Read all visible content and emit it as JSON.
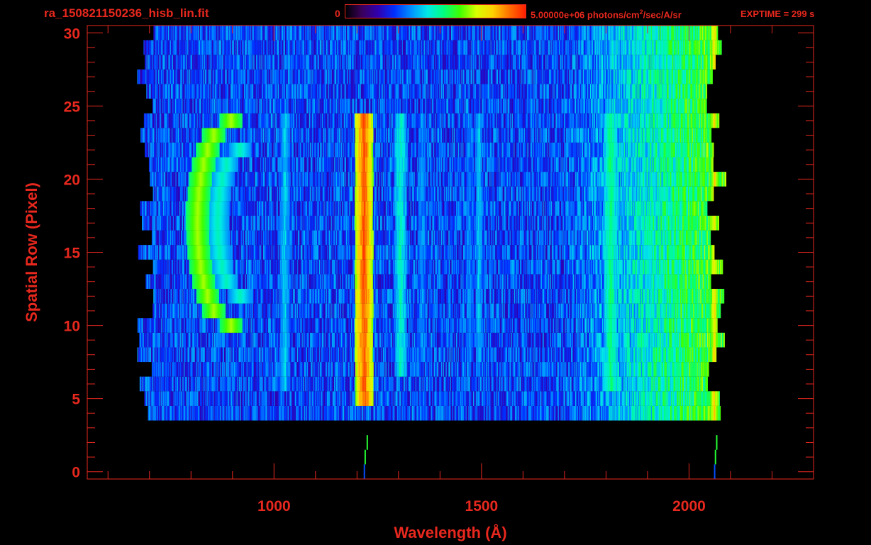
{
  "header": {
    "filename": "ra_150821150236_hisb_lin.fit",
    "colorbar_min_label": "0",
    "colorbar_max_prefix": "5.00000e+06 photons/cm",
    "colorbar_max_exp": "2",
    "colorbar_max_suffix": "/sec/A/sr",
    "exptime": "EXPTIME = 299 s"
  },
  "colors": {
    "axis": "#e8281e",
    "background": "#000000",
    "colormap": [
      "#000000",
      "#3a005a",
      "#3000b0",
      "#0030ff",
      "#0090ff",
      "#00e8e8",
      "#00ff80",
      "#40ff00",
      "#d8ff00",
      "#ffd000",
      "#ff7000",
      "#ff2000"
    ]
  },
  "chart_data": {
    "type": "heatmap",
    "title": "ra_150821150236_hisb_lin.fit",
    "xlabel": "Wavelength (Å)",
    "ylabel": "Spatial Row (Pixel)",
    "xlim": [
      550,
      2300
    ],
    "ylim": [
      -0.5,
      30.5
    ],
    "xticks": [
      1000,
      1500,
      2000
    ],
    "yticks": [
      0,
      5,
      10,
      15,
      20,
      25,
      30
    ],
    "colorbar": {
      "min": 0,
      "max": 5000000,
      "units": "photons/cm2/sec/A/sr"
    },
    "slit_rows": [
      4,
      30
    ],
    "data_x_range": [
      690,
      2090
    ],
    "features": [
      {
        "name": "Lyman-beta arc",
        "shape": "arc",
        "x_center": 855,
        "x_width": 90,
        "rows": [
          10,
          24
        ],
        "intensity": 0.55
      },
      {
        "name": "arc inner",
        "shape": "arc",
        "x_center": 890,
        "x_width": 60,
        "rows": [
          12,
          22
        ],
        "intensity": 0.35
      },
      {
        "name": "line 1025",
        "x": 1025,
        "width": 12,
        "rows": [
          6,
          24
        ],
        "intensity": 0.38
      },
      {
        "name": "Lyman-alpha",
        "x": 1216,
        "width": 22,
        "rows": [
          5,
          24
        ],
        "intensity": 0.9
      },
      {
        "name": "line 1304",
        "x": 1304,
        "width": 14,
        "rows": [
          7,
          24
        ],
        "intensity": 0.45
      },
      {
        "name": "line 1356",
        "x": 1356,
        "width": 10,
        "rows": [
          8,
          24
        ],
        "intensity": 0.32
      },
      {
        "name": "line 1470",
        "x": 1470,
        "width": 10,
        "rows": [
          8,
          24
        ],
        "intensity": 0.3
      },
      {
        "name": "line 1493",
        "x": 1493,
        "width": 8,
        "rows": [
          8,
          24
        ],
        "intensity": 0.38
      },
      {
        "name": "line 1810",
        "x": 1810,
        "width": 16,
        "rows": [
          6,
          24
        ],
        "intensity": 0.5
      },
      {
        "name": "red edge",
        "x": 2060,
        "width": 10,
        "rows": [
          3,
          30
        ],
        "intensity": 0.75
      }
    ]
  }
}
